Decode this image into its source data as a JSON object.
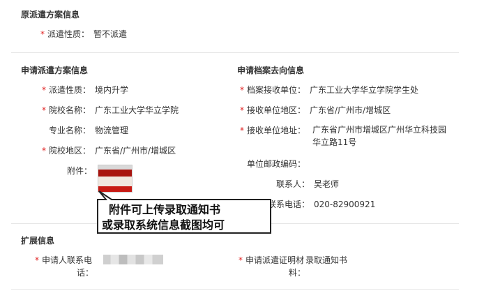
{
  "original": {
    "title": "原派遣方案信息",
    "dispatch_nature": {
      "label": "派遣性质：",
      "value": "暂不派遣"
    }
  },
  "apply": {
    "title": "申请派遣方案信息",
    "fields": [
      {
        "label": "派遣性质：",
        "value": "境内升学",
        "required": true
      },
      {
        "label": "院校名称：",
        "value": "广东工业大学华立学院",
        "required": true
      },
      {
        "label": "专业名称：",
        "value": "物流管理",
        "required": false
      },
      {
        "label": "院校地区：",
        "value": "广东省/广州市/增城区",
        "required": true
      },
      {
        "label": "附件：",
        "value": "",
        "required": false
      }
    ]
  },
  "archive": {
    "title": "申请档案去向信息",
    "fields": [
      {
        "label": "档案接收单位：",
        "value": "广东工业大学华立学院学生处",
        "required": true
      },
      {
        "label": "接收单位地区：",
        "value": "广东省/广州市/增城区",
        "required": true
      },
      {
        "label": "接收单位地址：",
        "value": "广东省广州市增城区广州华立科技园华立路11号",
        "required": true
      },
      {
        "label": "单位邮政编码：",
        "value": "",
        "required": false
      },
      {
        "label": "联系人：",
        "value": "吴老师",
        "required": false
      },
      {
        "label": "联系电话：",
        "value": "020-82900921",
        "required": false
      }
    ]
  },
  "extended": {
    "title": "扩展信息",
    "phone_label_line1": "申请人联系电",
    "phone_label_line2": "话：",
    "proof_label_line1": "申请派遣证明材",
    "proof_label_line2": "料：",
    "proof_value": "录取通知书"
  },
  "callout": {
    "line1": "附件可上传录取通知书",
    "line2": "或录取系统信息截图均可"
  },
  "colors": {
    "required": "#e02020",
    "divider": "#e6e6e6"
  }
}
